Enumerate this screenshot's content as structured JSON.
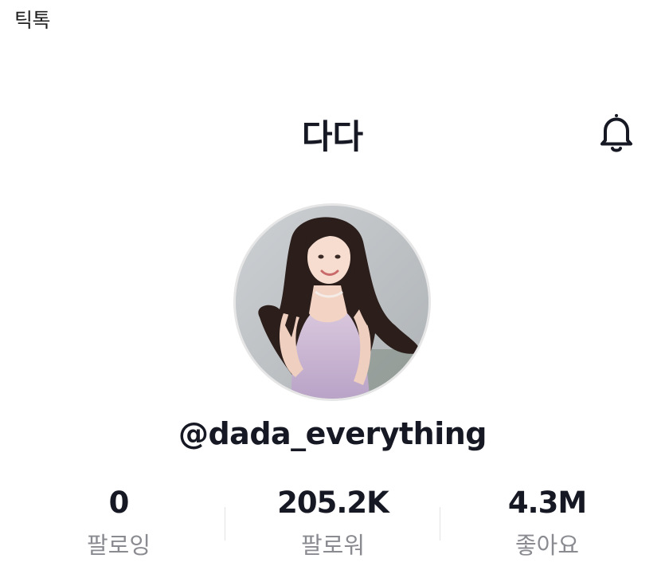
{
  "app": {
    "label": "틱톡"
  },
  "header": {
    "name": "다다",
    "notification_icon": "bell-icon"
  },
  "profile": {
    "avatar": "profile-photo",
    "username": "@dada_everything"
  },
  "stats": [
    {
      "value": "0",
      "label": "팔로잉"
    },
    {
      "value": "205.2K",
      "label": "팔로워"
    },
    {
      "value": "4.3M",
      "label": "좋아요"
    }
  ],
  "colors": {
    "primary_text": "#161823",
    "secondary_text": "#8a8b91",
    "divider": "#e3e3e4",
    "background": "#ffffff"
  }
}
